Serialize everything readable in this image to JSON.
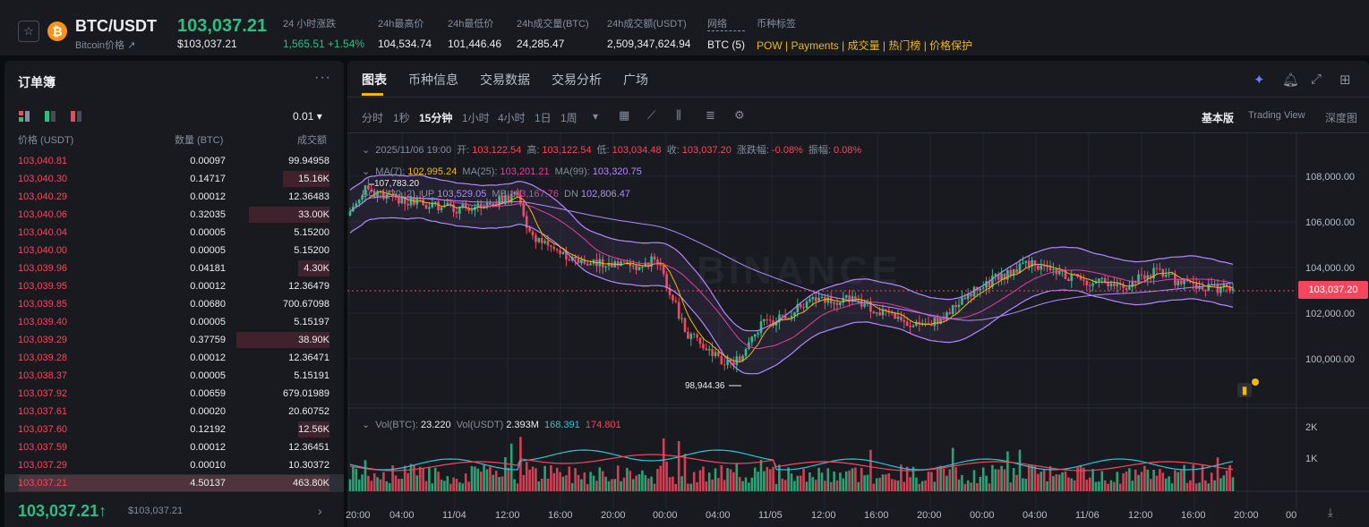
{
  "header": {
    "star_icon": "star-icon",
    "coin_icon_letter": "₿",
    "pair": "BTC/USDT",
    "pair_sub": "Bitcoin价格 ↗",
    "last_price": "103,037.21",
    "last_price_usd": "$103,037.21",
    "stats": [
      {
        "label": "24 小时涨跌",
        "value": "1,565.51 +1.54%",
        "kind": "green"
      },
      {
        "label": "24h最高价",
        "value": "104,534.74",
        "kind": "normal"
      },
      {
        "label": "24h最低价",
        "value": "101,446.46",
        "kind": "normal"
      },
      {
        "label": "24h成交量(BTC)",
        "value": "24,285.47",
        "kind": "normal"
      },
      {
        "label": "24h成交额(USDT)",
        "value": "2,509,347,624.94",
        "kind": "normal"
      },
      {
        "label": "网络",
        "value": "BTC (5)",
        "kind": "normal"
      },
      {
        "label": "币种标签",
        "value": "POW | Payments | 成交量 | 热门榜 | 价格保护",
        "kind": "tags"
      }
    ]
  },
  "orderbook": {
    "title": "订单簿",
    "more": "···",
    "step": "0.01 ▾",
    "col_price": "价格 (USDT)",
    "col_qty": "数量 (BTC)",
    "col_total": "成交额",
    "rows": [
      {
        "price": "103,040.81",
        "qty": "0.00097",
        "total": "99.94958",
        "depth": 0
      },
      {
        "price": "103,040.30",
        "qty": "0.14717",
        "total": "15.16K",
        "depth": 0.15
      },
      {
        "price": "103,040.29",
        "qty": "0.00012",
        "total": "12.36483",
        "depth": 0
      },
      {
        "price": "103,040.06",
        "qty": "0.32035",
        "total": "33.00K",
        "depth": 0.26
      },
      {
        "price": "103,040.04",
        "qty": "0.00005",
        "total": "5.15200",
        "depth": 0
      },
      {
        "price": "103,040.00",
        "qty": "0.00005",
        "total": "5.15200",
        "depth": 0
      },
      {
        "price": "103,039.96",
        "qty": "0.04181",
        "total": "4.30K",
        "depth": 0.1
      },
      {
        "price": "103,039.95",
        "qty": "0.00012",
        "total": "12.36479",
        "depth": 0
      },
      {
        "price": "103,039.85",
        "qty": "0.00680",
        "total": "700.67098",
        "depth": 0
      },
      {
        "price": "103,039.40",
        "qty": "0.00005",
        "total": "5.15197",
        "depth": 0
      },
      {
        "price": "103,039.29",
        "qty": "0.37759",
        "total": "38.90K",
        "depth": 0.3
      },
      {
        "price": "103,039.28",
        "qty": "0.00012",
        "total": "12.36471",
        "depth": 0
      },
      {
        "price": "103,038.37",
        "qty": "0.00005",
        "total": "5.15191",
        "depth": 0
      },
      {
        "price": "103,037.92",
        "qty": "0.00659",
        "total": "679.01989",
        "depth": 0
      },
      {
        "price": "103,037.61",
        "qty": "0.00020",
        "total": "20.60752",
        "depth": 0
      },
      {
        "price": "103,037.60",
        "qty": "0.12192",
        "total": "12.56K",
        "depth": 0.1
      },
      {
        "price": "103,037.59",
        "qty": "0.00012",
        "total": "12.36451",
        "depth": 0
      },
      {
        "price": "103,037.29",
        "qty": "0.00010",
        "total": "10.30372",
        "depth": 0
      },
      {
        "price": "103,037.21",
        "qty": "4.50137",
        "total": "463.80K",
        "depth": 1.0
      }
    ],
    "last_price": "103,037.21",
    "last_arrow": "↑",
    "last_usd": "$103,037.21",
    "arrow_right": "›"
  },
  "chart_panel": {
    "tabs": [
      "图表",
      "币种信息",
      "交易数据",
      "交易分析",
      "广场"
    ],
    "intervals": [
      "分时",
      "1秒",
      "15分钟",
      "1小时",
      "4小时",
      "1日",
      "1周"
    ],
    "active_interval": "15分钟",
    "view_options": [
      "基本版",
      "Trading View",
      "深度图"
    ],
    "ohlc": {
      "time": "2025/11/06 19:00",
      "open_label": "开:",
      "open": "103,122.54",
      "high_label": "高:",
      "high": "103,122.54",
      "low_label": "低:",
      "low": "103,034.48",
      "close_label": "收:",
      "close": "103,037.20",
      "chg_label": "涨跌幅:",
      "chg": "-0.08%",
      "amp_label": "振幅:",
      "amp": "0.08%"
    },
    "ma": {
      "ma7_label": "MA(7):",
      "ma7": "102,995.24",
      "ma25_label": "MA(25):",
      "ma25": "103,201.21",
      "ma99_label": "MA(99):",
      "ma99": "103,320.75"
    },
    "boll": {
      "label": "BOLL(20, 2)",
      "up_label": "UP",
      "up": "103,529.05",
      "mb_label": "MB",
      "mb": "103,167.76",
      "dn_label": "DN",
      "dn": "102,806.47"
    },
    "vol": {
      "label": "Vol(BTC):",
      "btc": "23.220",
      "usdt_label": "Vol(USDT)",
      "usdt": "2.393M",
      "v1": "168.391",
      "v2": "174.801"
    },
    "price_tag": "103,037.20",
    "high_marker": "107,783.20",
    "low_marker": "98,944.36",
    "watermark": "BINANCE",
    "y_labels": [
      "108,000.00",
      "106,000.00",
      "104,000.00",
      "102,000.00",
      "100,000.00"
    ],
    "vol_labels": [
      "2K",
      "1K"
    ],
    "x_labels": [
      "20:00",
      "04:00",
      "11/04",
      "12:00",
      "16:00",
      "20:00",
      "00:00",
      "04:00",
      "11/05",
      "12:00",
      "16:00",
      "20:00",
      "00:00",
      "04:00",
      "11/06",
      "12:00",
      "16:00",
      "20:00",
      "00"
    ]
  },
  "colors": {
    "up": "#2ebd85",
    "down": "#f6465d",
    "accent": "#f0b90b",
    "ma7": "#f0b90b",
    "ma25": "#e040a0",
    "ma99": "#b388ff",
    "boll": "#b388ff"
  }
}
